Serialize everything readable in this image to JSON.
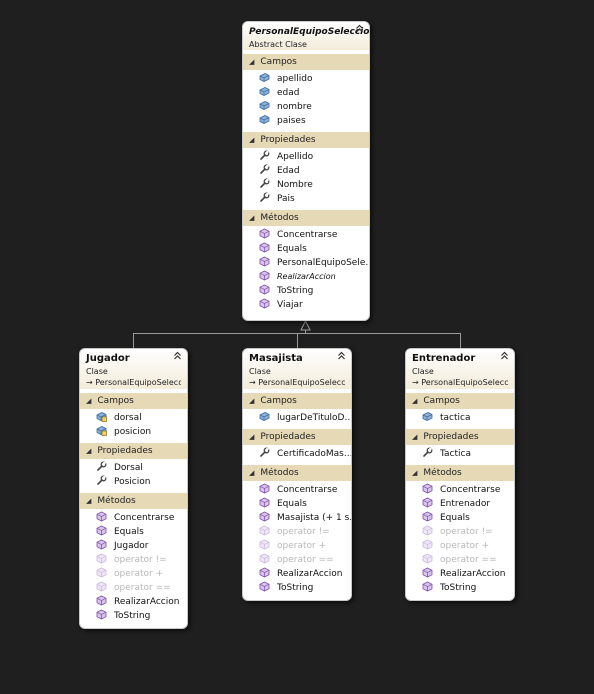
{
  "colors": {
    "background": "#1f1f1f",
    "section_header": "#e6d9b6",
    "card_header_gradient_end": "#f3ecda",
    "disabled_text": "#b8b8b8",
    "connector": "#9a9a9a"
  },
  "icons": {
    "field": "field-icon",
    "field_protected": "protected-field-icon",
    "property": "wrench-icon",
    "method": "method-icon",
    "collapse": "double-chevron-up-icon",
    "section_toggle": "triangle-down-icon",
    "inheritance": "inheritance-arrow-icon"
  },
  "classes": [
    {
      "id": "personal",
      "name": "PersonalEquipoSeleccion",
      "stereotype": "Abstract Clase",
      "inherits": "",
      "sections": [
        {
          "title": "Campos",
          "kind": "field",
          "items": [
            {
              "label": "apellido"
            },
            {
              "label": "edad"
            },
            {
              "label": "nombre"
            },
            {
              "label": "paises"
            }
          ]
        },
        {
          "title": "Propiedades",
          "kind": "property",
          "items": [
            {
              "label": "Apellido"
            },
            {
              "label": "Edad"
            },
            {
              "label": "Nombre"
            },
            {
              "label": "Pais"
            }
          ]
        },
        {
          "title": "Métodos",
          "kind": "method",
          "items": [
            {
              "label": "Concentrarse"
            },
            {
              "label": "Equals"
            },
            {
              "label": "PersonalEquipoSele..."
            },
            {
              "label": "RealizarAccion",
              "style": "italic"
            },
            {
              "label": "ToString"
            },
            {
              "label": "Viajar"
            }
          ]
        }
      ]
    },
    {
      "id": "jugador",
      "name": "Jugador",
      "stereotype": "Clase",
      "inherits": "PersonalEquipoSelecci...",
      "sections": [
        {
          "title": "Campos",
          "kind": "field_protected",
          "items": [
            {
              "label": "dorsal"
            },
            {
              "label": "posicion"
            }
          ]
        },
        {
          "title": "Propiedades",
          "kind": "property",
          "items": [
            {
              "label": "Dorsal"
            },
            {
              "label": "Posicion"
            }
          ]
        },
        {
          "title": "Métodos",
          "kind": "method",
          "items": [
            {
              "label": "Concentrarse"
            },
            {
              "label": "Equals"
            },
            {
              "label": "Jugador"
            },
            {
              "label": "operator !=",
              "style": "grey"
            },
            {
              "label": "operator +",
              "style": "grey"
            },
            {
              "label": "operator ==",
              "style": "grey"
            },
            {
              "label": "RealizarAccion"
            },
            {
              "label": "ToString"
            }
          ]
        }
      ]
    },
    {
      "id": "masajista",
      "name": "Masajista",
      "stereotype": "Clase",
      "inherits": "PersonalEquipoSelecci...",
      "sections": [
        {
          "title": "Campos",
          "kind": "field",
          "items": [
            {
              "label": "lugarDeTituloD..."
            }
          ]
        },
        {
          "title": "Propiedades",
          "kind": "property",
          "items": [
            {
              "label": "CertificadoMas..."
            }
          ]
        },
        {
          "title": "Métodos",
          "kind": "method",
          "items": [
            {
              "label": "Concentrarse"
            },
            {
              "label": "Equals"
            },
            {
              "label": "Masajista (+ 1 s..."
            },
            {
              "label": "operator !=",
              "style": "grey"
            },
            {
              "label": "operator +",
              "style": "grey"
            },
            {
              "label": "operator ==",
              "style": "grey"
            },
            {
              "label": "RealizarAccion"
            },
            {
              "label": "ToString"
            }
          ]
        }
      ]
    },
    {
      "id": "entrenador",
      "name": "Entrenador",
      "stereotype": "Clase",
      "inherits": "PersonalEquipoSelecci...",
      "sections": [
        {
          "title": "Campos",
          "kind": "field",
          "items": [
            {
              "label": "tactica"
            }
          ]
        },
        {
          "title": "Propiedades",
          "kind": "property",
          "items": [
            {
              "label": "Tactica"
            }
          ]
        },
        {
          "title": "Métodos",
          "kind": "method",
          "items": [
            {
              "label": "Concentrarse"
            },
            {
              "label": "Entrenador"
            },
            {
              "label": "Equals"
            },
            {
              "label": "operator !=",
              "style": "grey"
            },
            {
              "label": "operator +",
              "style": "grey"
            },
            {
              "label": "operator ==",
              "style": "grey"
            },
            {
              "label": "RealizarAccion"
            },
            {
              "label": "ToString"
            }
          ]
        }
      ]
    }
  ]
}
